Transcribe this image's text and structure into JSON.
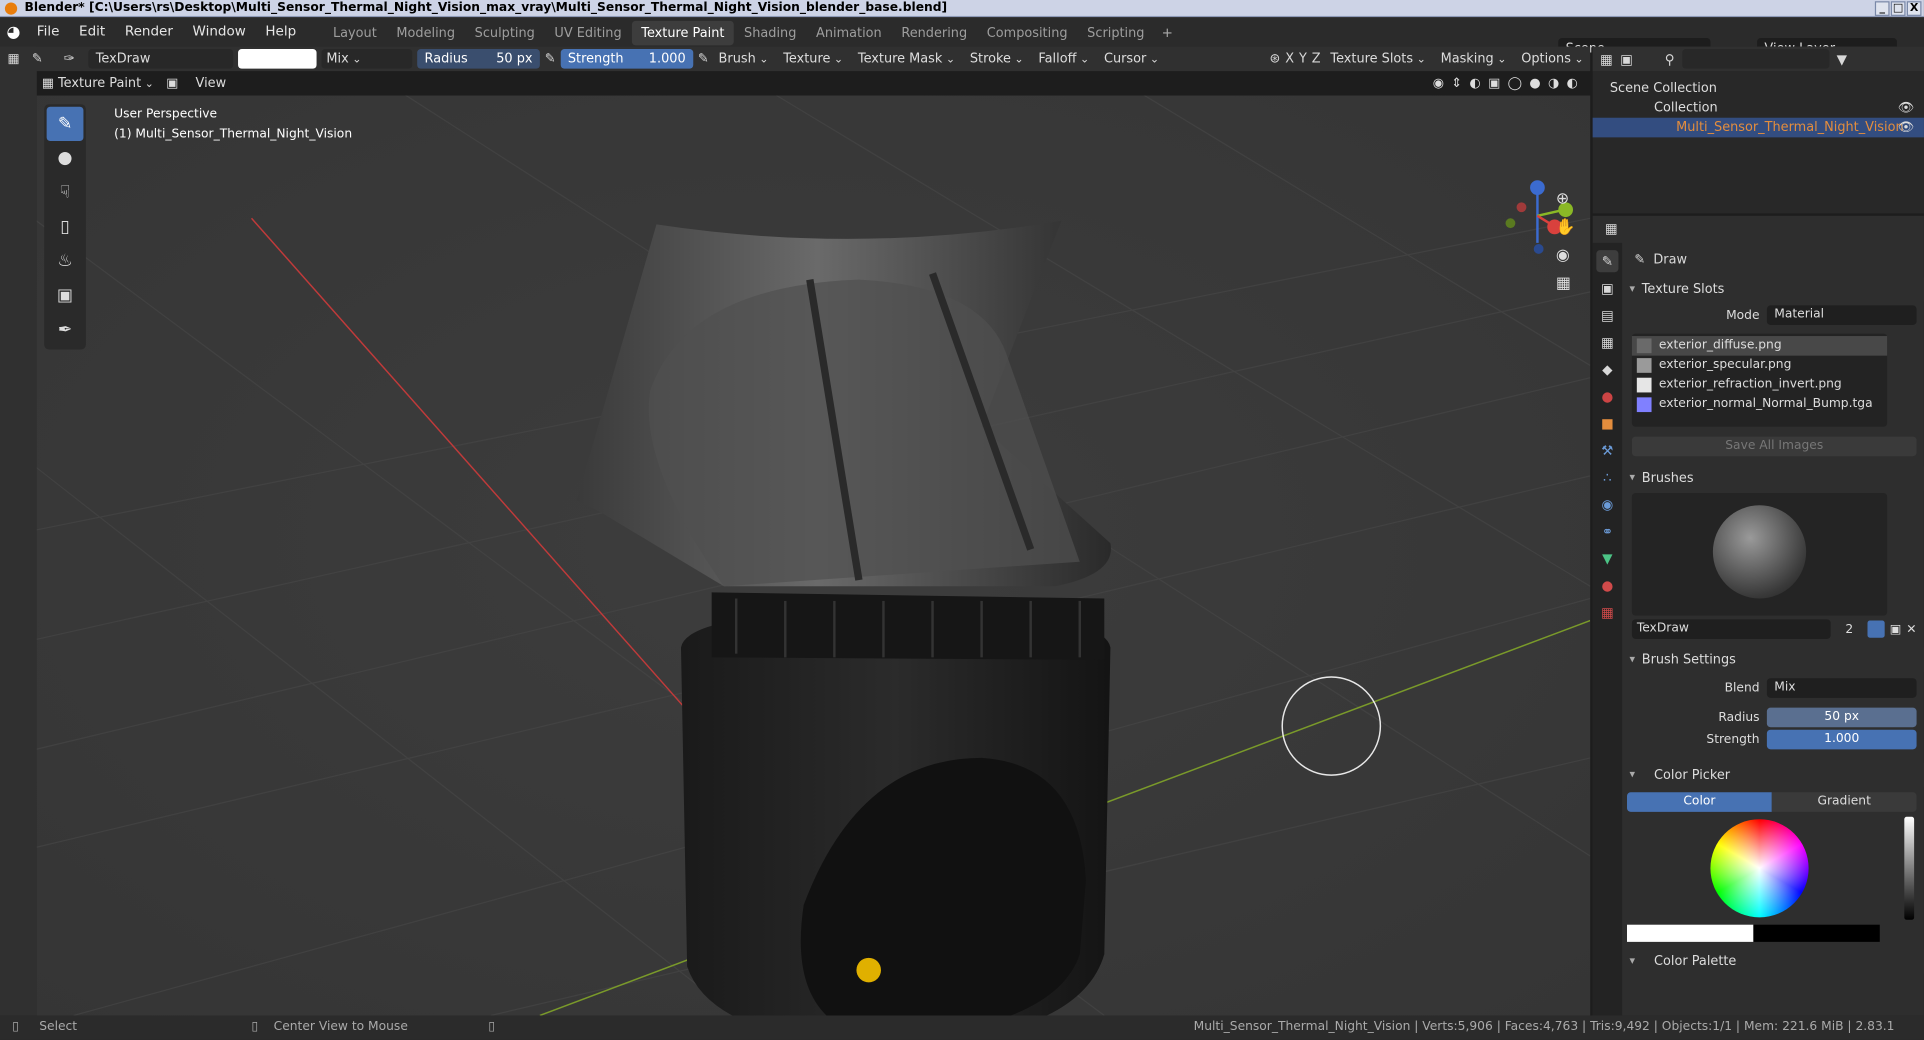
{
  "window": {
    "title": "Blender* [C:\\Users\\rs\\Desktop\\Multi_Sensor_Thermal_Night_Vision_max_vray\\Multi_Sensor_Thermal_Night_Vision_blender_base.blend]",
    "btn_min": "_",
    "btn_max": "□",
    "btn_close": "X"
  },
  "menu": [
    "File",
    "Edit",
    "Render",
    "Window",
    "Help"
  ],
  "workspaces": [
    "Layout",
    "Modeling",
    "Sculpting",
    "UV Editing",
    "Texture Paint",
    "Shading",
    "Animation",
    "Rendering",
    "Compositing",
    "Scripting"
  ],
  "workspace_active": "Texture Paint",
  "scene": "Scene",
  "view_layer": "View Layer",
  "toolbar": {
    "brush_name": "TexDraw",
    "blend": "Mix",
    "radius_label": "Radius",
    "radius_value": "50 px",
    "strength_label": "Strength",
    "strength_value": "1.000",
    "brush": "Brush",
    "texture": "Texture",
    "texture_mask": "Texture Mask",
    "stroke": "Stroke",
    "falloff": "Falloff",
    "cursor": "Cursor",
    "x": "X",
    "y": "Y",
    "z": "Z",
    "texture_slots": "Texture Slots",
    "masking": "Masking",
    "options": "Options"
  },
  "subbar": {
    "mode": "Texture Paint",
    "view": "View"
  },
  "viewport": {
    "line1": "User Perspective",
    "line2": "(1) Multi_Sensor_Thermal_Night_Vision",
    "gizmo_x": "X",
    "gizmo_y": "Y",
    "gizmo_z": "Z"
  },
  "outliner": {
    "scene_collection": "Scene Collection",
    "collection": "Collection",
    "object": "Multi_Sensor_Thermal_Night_Vision"
  },
  "properties": {
    "tool_name": "Draw",
    "texture_slots_header": "Texture Slots",
    "mode_label": "Mode",
    "mode_value": "Material",
    "slots": [
      {
        "name": "exterior_diffuse.png",
        "swatch": "#6a6a6a"
      },
      {
        "name": "exterior_specular.png",
        "swatch": "#9a9a9a"
      },
      {
        "name": "exterior_refraction_invert.png",
        "swatch": "#e6e6e6"
      },
      {
        "name": "exterior_normal_Normal_Bump.tga",
        "swatch": "#8080ff"
      }
    ],
    "save_all": "Save All Images",
    "brushes_header": "Brushes",
    "brush_name": "TexDraw",
    "brush_users": "2",
    "brush_settings_header": "Brush Settings",
    "blend_label": "Blend",
    "blend_value": "Mix",
    "radius_label": "Radius",
    "radius_value": "50 px",
    "strength_label": "Strength",
    "strength_value": "1.000",
    "color_picker_header": "Color Picker",
    "color_tab": "Color",
    "gradient_tab": "Gradient",
    "color_palette": "Color Palette"
  },
  "status": {
    "select": "Select",
    "center": "Center View to Mouse",
    "stats": "Multi_Sensor_Thermal_Night_Vision | Verts:5,906 | Faces:4,763 | Tris:9,492 | Objects:1/1 | Mem: 221.6 MiB | 2.83.1"
  },
  "colors": {
    "accent": "#4772b3",
    "selected_text": "#e38d3d",
    "bg": "#3a3a3a"
  }
}
